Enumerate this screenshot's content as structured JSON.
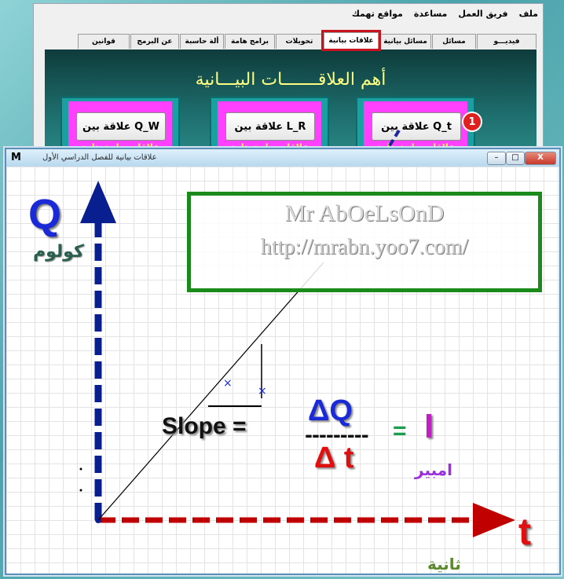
{
  "menubar": {
    "items": [
      "ملف",
      "فريق العمل",
      "مساعدة",
      "مواقع تهمك"
    ]
  },
  "tabs": [
    {
      "label": "فيديـــو",
      "active": false
    },
    {
      "label": "مسائل",
      "active": false
    },
    {
      "label": "مسائل بيانية",
      "active": false
    },
    {
      "label": "علاقات بيانية",
      "active": true
    },
    {
      "label": "تحويلات",
      "active": false
    },
    {
      "label": "برامج هامة",
      "active": false
    },
    {
      "label": "ألة حاسبة",
      "active": false
    },
    {
      "label": "عن البرمج",
      "active": false
    },
    {
      "label": "قوانين",
      "active": false
    }
  ],
  "panel": {
    "title": "أهم العلاقـــــــات البيـــانية",
    "buttons": [
      {
        "label": "علاقة بين Q_t",
        "sub": "علاقات بيانية هامة"
      },
      {
        "label": "علاقة بين L_R",
        "sub": "علاقات بيانية هامة"
      },
      {
        "label": "علاقة بين Q_W",
        "sub": "علاقات بيانية هامة"
      }
    ],
    "badge": "1"
  },
  "front_window": {
    "title": "علاقات بيانية للفصل الدراسي الأول",
    "icon": "M",
    "controls": {
      "minimize": "–",
      "maximize": "□",
      "close": "X"
    }
  },
  "graph": {
    "y_axis_label": "Q",
    "y_unit": "كولوم",
    "x_axis_label": "t",
    "x_unit": "ثانية",
    "formula": {
      "left": "Slope =",
      "numerator": "ΔQ",
      "denominator": "Δ t",
      "dashes": "---------",
      "equals": "=",
      "result": "I",
      "result_unit": "امبير"
    },
    "watermark": {
      "line1": "Mr AbOeLsOnD",
      "line2": "http://mrabn.yoo7.com/"
    },
    "colors": {
      "axis_y": "#0a1f8f",
      "axis_x": "#c00000",
      "frame": "#1a8a1a"
    }
  }
}
